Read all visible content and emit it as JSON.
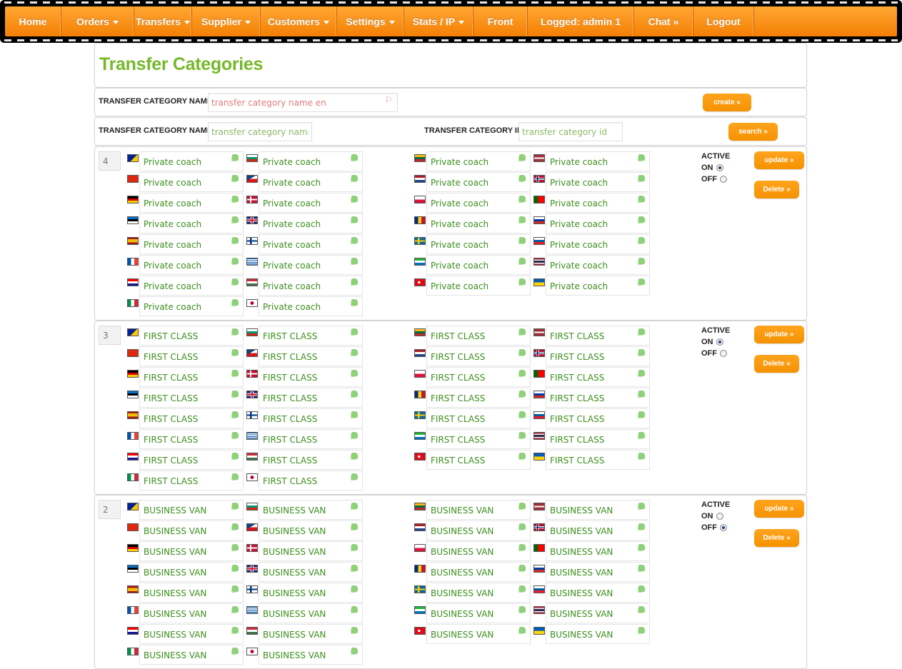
{
  "nav": [
    {
      "label": "Home",
      "caret": false
    },
    {
      "label": "Orders",
      "caret": true
    },
    {
      "label": "Transfers",
      "caret": true
    },
    {
      "label": "Supplier",
      "caret": true
    },
    {
      "label": "Customers",
      "caret": true
    },
    {
      "label": "Settings",
      "caret": true
    },
    {
      "label": "Stats / IP",
      "caret": true
    },
    {
      "label": "Front",
      "caret": false
    },
    {
      "label": "Logged: admin 1",
      "caret": false
    },
    {
      "label": "Chat »",
      "caret": false
    },
    {
      "label": "Logout",
      "caret": false
    }
  ],
  "page": {
    "title": "Transfer Categories"
  },
  "create_form": {
    "name_label": "TRANSFER CATEGORY NAME",
    "name_placeholder": "transfer category name en",
    "create_label": "create »"
  },
  "search_form": {
    "name_label": "TRANSFER CATEGORY NAME",
    "name_placeholder": "transfer category name",
    "id_label": "TRANSFER CATEGORY ID",
    "id_placeholder": "transfer category id",
    "search_label": "search »"
  },
  "labels": {
    "active": "ACTIVE",
    "on": "ON",
    "off": "OFF",
    "update": "update »",
    "delete": "Delete »"
  },
  "flag_columns": [
    [
      "ba",
      "bg"
    ],
    [
      "cn",
      "cz"
    ],
    [
      "de",
      "dk"
    ],
    [
      "ee",
      "gb"
    ],
    [
      "es",
      "fi"
    ],
    [
      "fr",
      "gr"
    ],
    [
      "hr",
      "hu"
    ],
    [
      "it",
      "jp"
    ]
  ],
  "flag_columns_right": [
    [
      "lt",
      "lv"
    ],
    [
      "nl",
      "no"
    ],
    [
      "pl",
      "pt"
    ],
    [
      "ro",
      "ru"
    ],
    [
      "se",
      "si"
    ],
    [
      "sl",
      "th"
    ],
    [
      "tr",
      "ua"
    ]
  ],
  "categories": [
    {
      "id": "4",
      "name": "Private coach",
      "active": "on"
    },
    {
      "id": "3",
      "name": "FIRST CLASS",
      "active": "on"
    },
    {
      "id": "2",
      "name": "BUSINESS VAN",
      "active": "off"
    }
  ]
}
